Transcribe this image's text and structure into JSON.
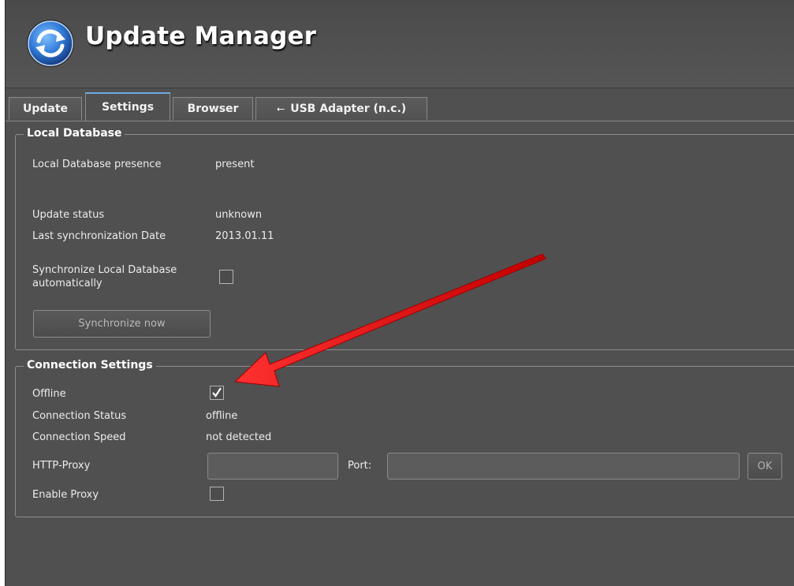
{
  "app": {
    "title": "Update Manager"
  },
  "tabs": [
    {
      "label": "Update",
      "active": false
    },
    {
      "label": "Settings",
      "active": true
    },
    {
      "label": "Browser",
      "active": false
    },
    {
      "label": "USB Adapter (n.c.)",
      "active": false,
      "icon": "usb-icon",
      "icon_glyph": "⭠"
    }
  ],
  "local_db": {
    "title": "Local Database",
    "presence_label": "Local Database presence",
    "presence_value": "present",
    "update_status_label": "Update status",
    "update_status_value": "unknown",
    "last_sync_label": "Last synchronization Date",
    "last_sync_value": "2013.01.11",
    "auto_sync_label": "Synchronize Local Database automatically",
    "auto_sync_checked": false,
    "sync_now_label": "Synchronize now"
  },
  "connection": {
    "title": "Connection Settings",
    "offline_label": "Offline",
    "offline_checked": true,
    "status_label": "Connection Status",
    "status_value": "offline",
    "speed_label": "Connection Speed",
    "speed_value": "not detected",
    "proxy_label": "HTTP-Proxy",
    "proxy_value": "",
    "port_label": "Port:",
    "port_value": "",
    "ok_label": "OK",
    "enable_proxy_label": "Enable Proxy",
    "enable_proxy_checked": false
  },
  "colors": {
    "background": "#505050",
    "accent_tab": "#6fa8e0",
    "annotation_arrow": "#e81010"
  }
}
